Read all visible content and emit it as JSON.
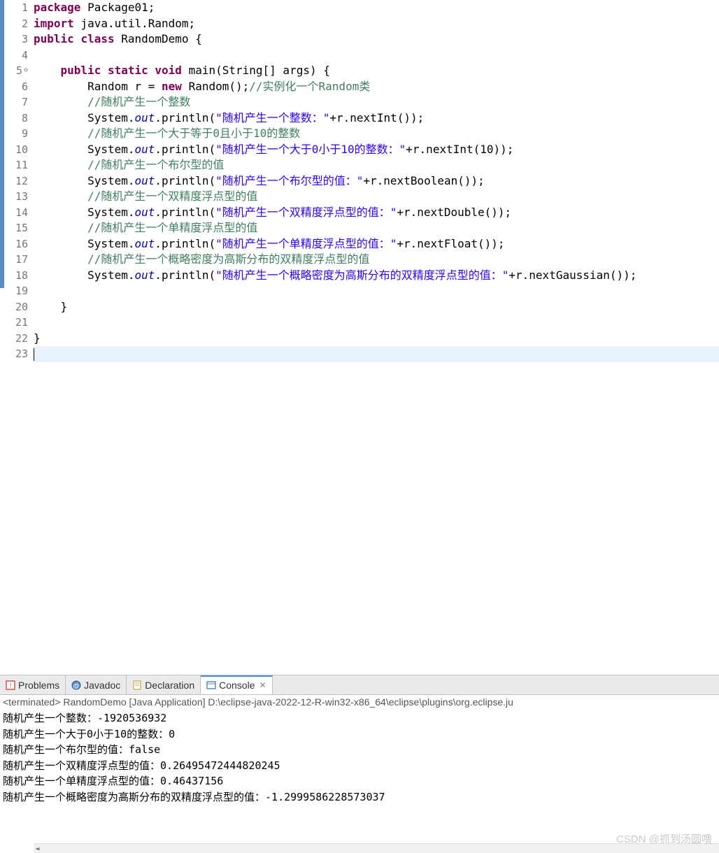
{
  "editor": {
    "lines": [
      {
        "num": 1,
        "marker": "",
        "segments": [
          {
            "cls": "kw",
            "t": "package"
          },
          {
            "cls": "normal",
            "t": " Package01;"
          }
        ]
      },
      {
        "num": 2,
        "marker": "",
        "segments": [
          {
            "cls": "kw",
            "t": "import"
          },
          {
            "cls": "normal",
            "t": " java.util.Random;"
          }
        ]
      },
      {
        "num": 3,
        "marker": "",
        "segments": [
          {
            "cls": "kw",
            "t": "public"
          },
          {
            "cls": "normal",
            "t": " "
          },
          {
            "cls": "kw",
            "t": "class"
          },
          {
            "cls": "normal",
            "t": " RandomDemo {"
          }
        ]
      },
      {
        "num": 4,
        "marker": "",
        "segments": []
      },
      {
        "num": 5,
        "marker": "⊖",
        "segments": [
          {
            "cls": "normal",
            "t": "    "
          },
          {
            "cls": "kw",
            "t": "public"
          },
          {
            "cls": "normal",
            "t": " "
          },
          {
            "cls": "kw",
            "t": "static"
          },
          {
            "cls": "normal",
            "t": " "
          },
          {
            "cls": "kw",
            "t": "void"
          },
          {
            "cls": "normal",
            "t": " main(String[] args) {"
          }
        ]
      },
      {
        "num": 6,
        "marker": "",
        "segments": [
          {
            "cls": "normal",
            "t": "        Random r = "
          },
          {
            "cls": "kw",
            "t": "new"
          },
          {
            "cls": "normal",
            "t": " Random();"
          },
          {
            "cls": "comment",
            "t": "//实例化一个Random类"
          }
        ]
      },
      {
        "num": 7,
        "marker": "",
        "segments": [
          {
            "cls": "normal",
            "t": "        "
          },
          {
            "cls": "comment",
            "t": "//随机产生一个整数"
          }
        ]
      },
      {
        "num": 8,
        "marker": "",
        "segments": [
          {
            "cls": "normal",
            "t": "        System."
          },
          {
            "cls": "field",
            "t": "out"
          },
          {
            "cls": "normal",
            "t": ".println("
          },
          {
            "cls": "string",
            "t": "\"随机产生一个整数：\""
          },
          {
            "cls": "normal",
            "t": "+r.nextInt());"
          }
        ]
      },
      {
        "num": 9,
        "marker": "",
        "segments": [
          {
            "cls": "normal",
            "t": "        "
          },
          {
            "cls": "comment",
            "t": "//随机产生一个大于等于0且小于10的整数"
          }
        ]
      },
      {
        "num": 10,
        "marker": "",
        "segments": [
          {
            "cls": "normal",
            "t": "        System."
          },
          {
            "cls": "field",
            "t": "out"
          },
          {
            "cls": "normal",
            "t": ".println("
          },
          {
            "cls": "string",
            "t": "\"随机产生一个大于0小于10的整数：\""
          },
          {
            "cls": "normal",
            "t": "+r.nextInt(10));"
          }
        ]
      },
      {
        "num": 11,
        "marker": "",
        "segments": [
          {
            "cls": "normal",
            "t": "        "
          },
          {
            "cls": "comment",
            "t": "//随机产生一个布尔型的值"
          }
        ]
      },
      {
        "num": 12,
        "marker": "",
        "segments": [
          {
            "cls": "normal",
            "t": "        System."
          },
          {
            "cls": "field",
            "t": "out"
          },
          {
            "cls": "normal",
            "t": ".println("
          },
          {
            "cls": "string",
            "t": "\"随机产生一个布尔型的值：\""
          },
          {
            "cls": "normal",
            "t": "+r.nextBoolean());"
          }
        ]
      },
      {
        "num": 13,
        "marker": "",
        "segments": [
          {
            "cls": "normal",
            "t": "        "
          },
          {
            "cls": "comment",
            "t": "//随机产生一个双精度浮点型的值"
          }
        ]
      },
      {
        "num": 14,
        "marker": "",
        "segments": [
          {
            "cls": "normal",
            "t": "        System."
          },
          {
            "cls": "field",
            "t": "out"
          },
          {
            "cls": "normal",
            "t": ".println("
          },
          {
            "cls": "string",
            "t": "\"随机产生一个双精度浮点型的值：\""
          },
          {
            "cls": "normal",
            "t": "+r.nextDouble());"
          }
        ]
      },
      {
        "num": 15,
        "marker": "",
        "segments": [
          {
            "cls": "normal",
            "t": "        "
          },
          {
            "cls": "comment",
            "t": "//随机产生一个单精度浮点型的值"
          }
        ]
      },
      {
        "num": 16,
        "marker": "",
        "segments": [
          {
            "cls": "normal",
            "t": "        System."
          },
          {
            "cls": "field",
            "t": "out"
          },
          {
            "cls": "normal",
            "t": ".println("
          },
          {
            "cls": "string",
            "t": "\"随机产生一个单精度浮点型的值：\""
          },
          {
            "cls": "normal",
            "t": "+r.nextFloat());"
          }
        ]
      },
      {
        "num": 17,
        "marker": "",
        "segments": [
          {
            "cls": "normal",
            "t": "        "
          },
          {
            "cls": "comment",
            "t": "//随机产生一个概略密度为高斯分布的双精度浮点型的值"
          }
        ]
      },
      {
        "num": 18,
        "marker": "",
        "segments": [
          {
            "cls": "normal",
            "t": "        System."
          },
          {
            "cls": "field",
            "t": "out"
          },
          {
            "cls": "normal",
            "t": ".println("
          },
          {
            "cls": "string",
            "t": "\"随机产生一个概略密度为高斯分布的双精度浮点型的值：\""
          },
          {
            "cls": "normal",
            "t": "+r.nextGaussian());"
          }
        ]
      },
      {
        "num": 19,
        "marker": "",
        "segments": []
      },
      {
        "num": 20,
        "marker": "",
        "segments": [
          {
            "cls": "normal",
            "t": "    }"
          }
        ]
      },
      {
        "num": 21,
        "marker": "",
        "segments": []
      },
      {
        "num": 22,
        "marker": "",
        "segments": [
          {
            "cls": "normal",
            "t": "}"
          }
        ]
      },
      {
        "num": 23,
        "marker": "",
        "current": true,
        "segments": []
      }
    ]
  },
  "tabs": {
    "problems": "Problems",
    "javadoc": "Javadoc",
    "declaration": "Declaration",
    "console": "Console"
  },
  "console": {
    "header": "<terminated> RandomDemo [Java Application] D:\\eclipse-java-2022-12-R-win32-x86_64\\eclipse\\plugins\\org.eclipse.ju",
    "lines": [
      "随机产生一个整数：-1920536932",
      "随机产生一个大于0小于10的整数：0",
      "随机产生一个布尔型的值：false",
      "随机产生一个双精度浮点型的值：0.26495472444820245",
      "随机产生一个单精度浮点型的值：0.46437156",
      "随机产生一个概略密度为高斯分布的双精度浮点型的值：-1.2999586228573037"
    ]
  },
  "watermark": "CSDN @抓到汤圆噜",
  "scroll_arrow": "◄"
}
